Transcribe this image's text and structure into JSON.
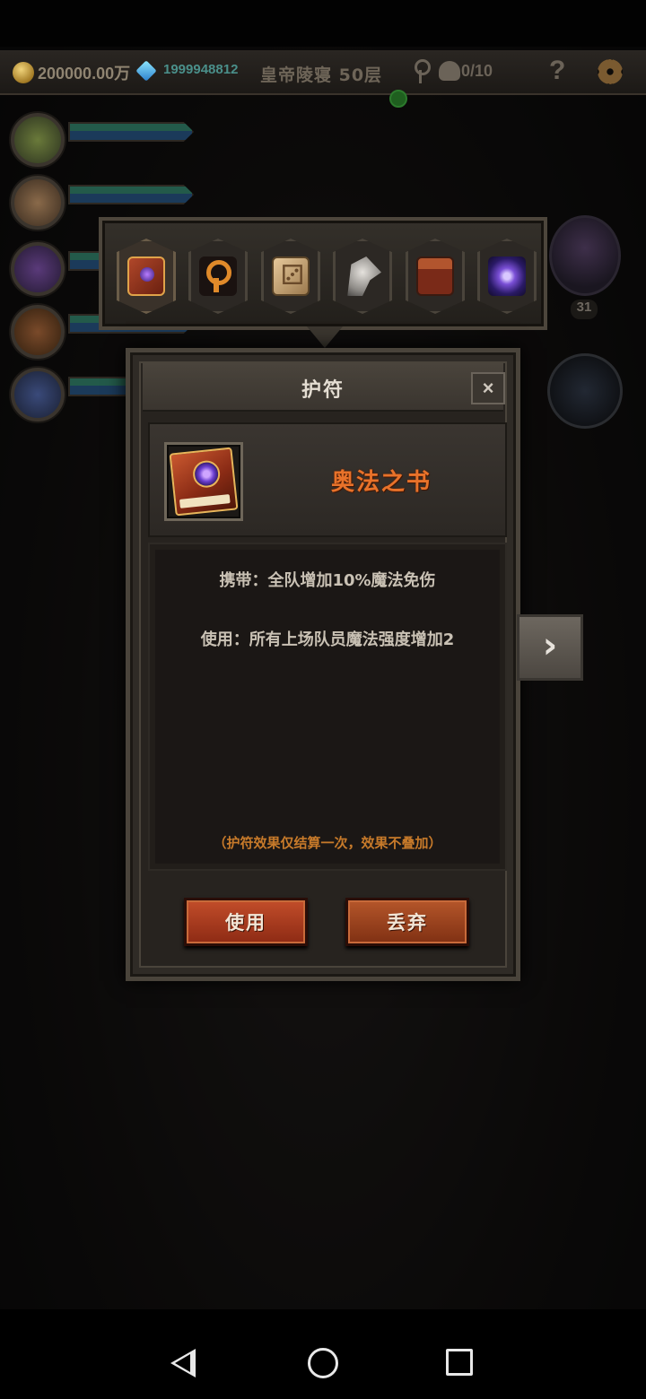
{
  "topbar": {
    "gold": "200000.00万",
    "gems": "1999948812",
    "floor": "皇帝陵寝 50层",
    "kills": "0/10",
    "help": "?"
  },
  "side": {
    "hero_level": "31"
  },
  "amulets": [
    {
      "icon": "spellbook-icon"
    },
    {
      "icon": "key-icon"
    },
    {
      "icon": "dice-icon"
    },
    {
      "icon": "wolf-icon"
    },
    {
      "icon": "drum-icon"
    },
    {
      "icon": "vortex-icon"
    }
  ],
  "dialog": {
    "title": "护符",
    "close": "×",
    "item_name": "奥法之书",
    "carry_effect": "携带：全队增加10%魔法免伤",
    "use_effect": "使用：所有上场队员魔法强度增加2",
    "note": "（护符效果仅结算一次，效果不叠加）",
    "use_label": "使用",
    "discard_label": "丢弃"
  },
  "next_arrow": "›"
}
